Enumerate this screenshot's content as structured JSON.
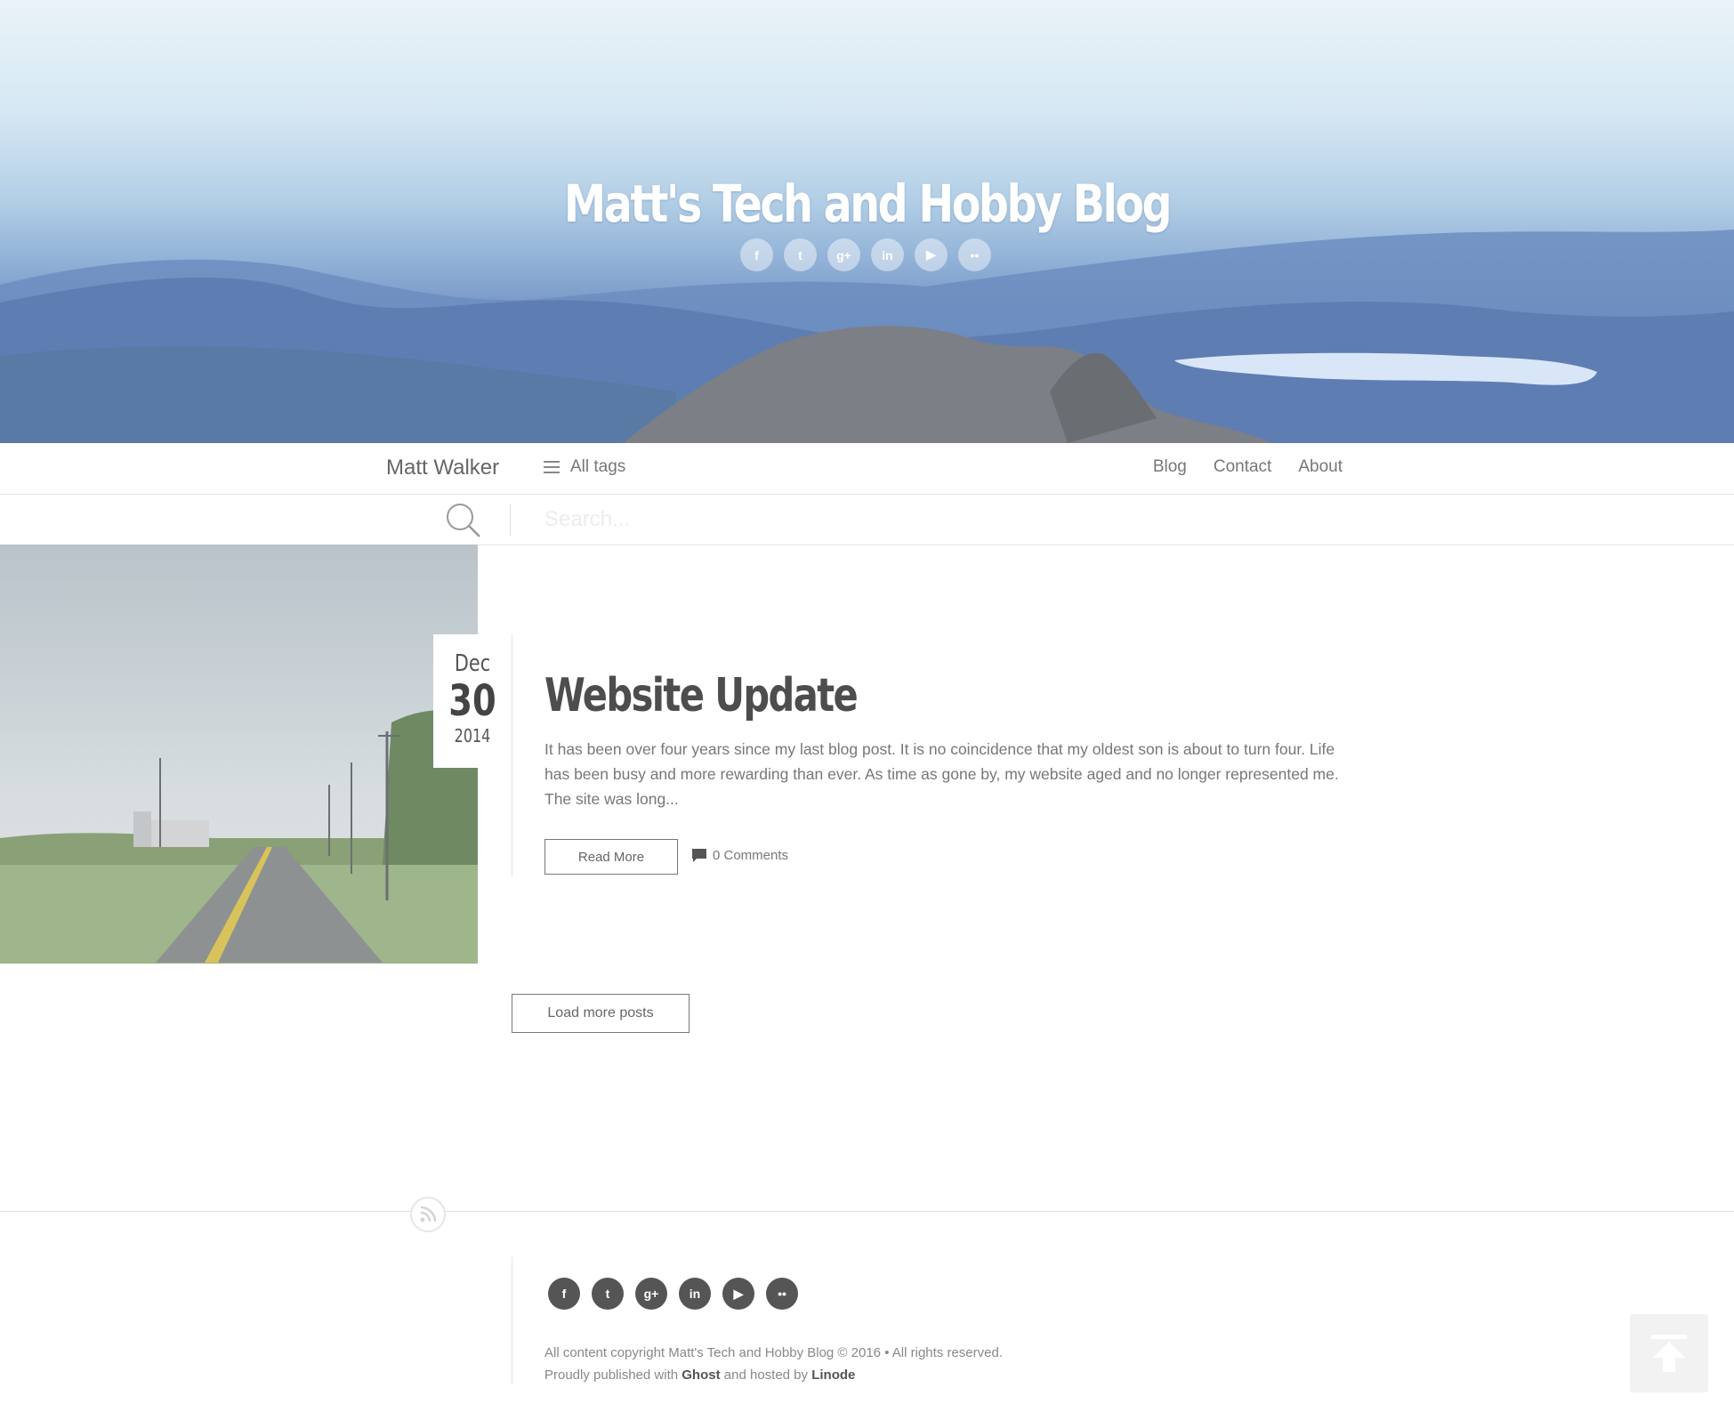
{
  "hero": {
    "title": "Matt's Tech and Hobby Blog",
    "social": [
      {
        "icon": "facebook-icon",
        "glyph": "f"
      },
      {
        "icon": "twitter-icon",
        "glyph": "t"
      },
      {
        "icon": "google-plus-icon",
        "glyph": "g+"
      },
      {
        "icon": "linkedin-icon",
        "glyph": "in"
      },
      {
        "icon": "youtube-icon",
        "glyph": "▶"
      },
      {
        "icon": "flickr-icon",
        "glyph": "••"
      }
    ]
  },
  "nav": {
    "brand": "Matt Walker",
    "all_tags": "All tags",
    "links": [
      "Blog",
      "Contact",
      "About"
    ]
  },
  "search": {
    "placeholder": "Search..."
  },
  "post": {
    "month": "Dec",
    "day": "30",
    "year": "2014",
    "title": "Website Update",
    "excerpt": "It has been over four years since my last blog post. It is no coincidence that my oldest son is about to turn four. Life has been busy and more rewarding than ever. As time as gone by, my website aged and no longer represented me. The site was long...",
    "read_more": "Read More",
    "comments": "0 Comments"
  },
  "load_more": "Load more posts",
  "footer": {
    "copyright": "All content copyright Matt's Tech and Hobby Blog © 2016 • All rights reserved.",
    "published_prefix": "Proudly published with",
    "ghost": "Ghost",
    "hosted_mid": "and hosted by",
    "linode": "Linode"
  },
  "colors": {
    "text": "#555555",
    "muted": "#777777",
    "border": "#e3e3e3",
    "footer_social_bg": "#555555"
  }
}
